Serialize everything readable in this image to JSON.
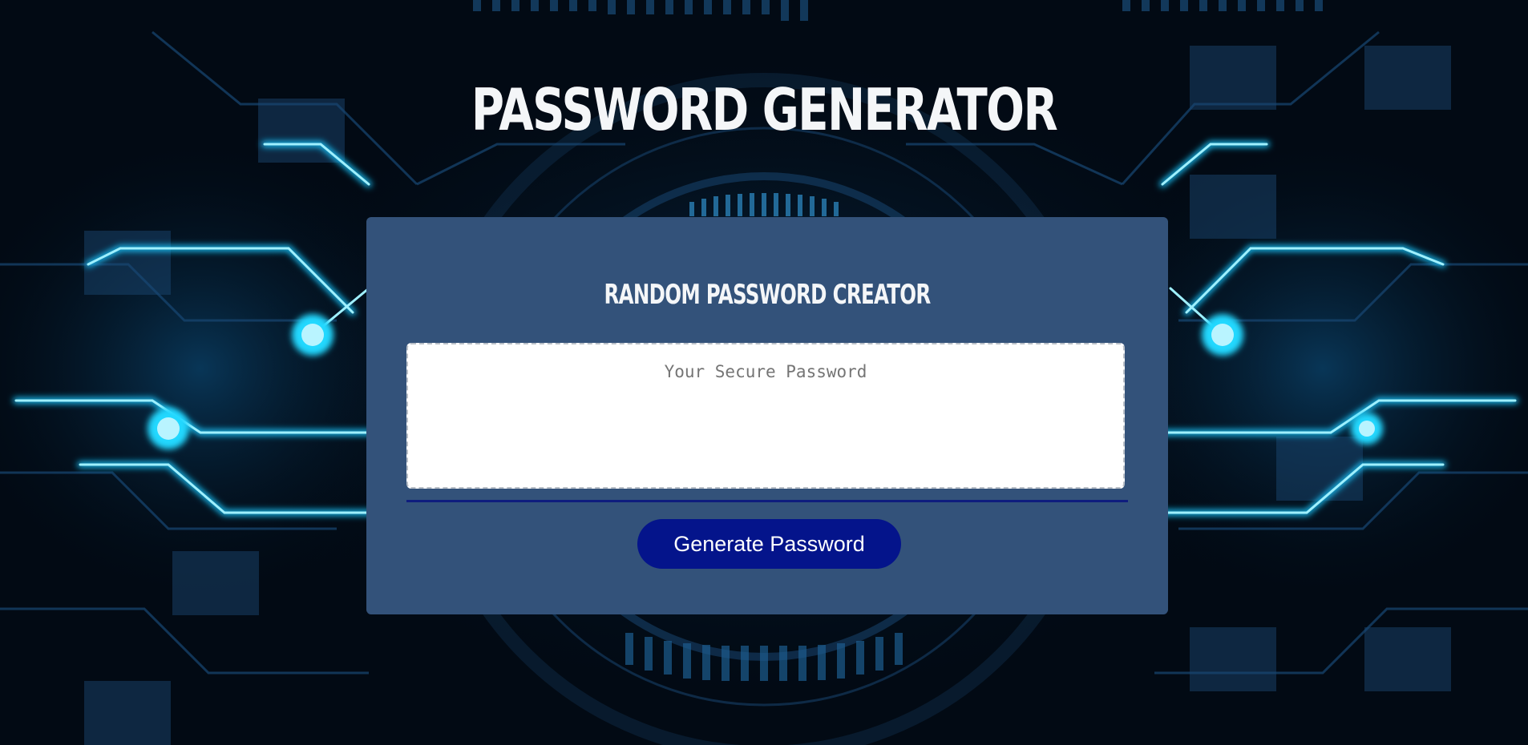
{
  "header": {
    "title": "PASSWORD GENERATOR"
  },
  "card": {
    "title": "RANDOM PASSWORD CREATOR",
    "password_placeholder": "Your Secure Password",
    "password_value": "",
    "generate_label": "Generate Password"
  },
  "colors": {
    "card_background": "#33527a",
    "button_background": "#04148b",
    "divider": "#0f1d7e",
    "title_text": "#f4f6f8",
    "background_glow": "#1fd6ff"
  }
}
